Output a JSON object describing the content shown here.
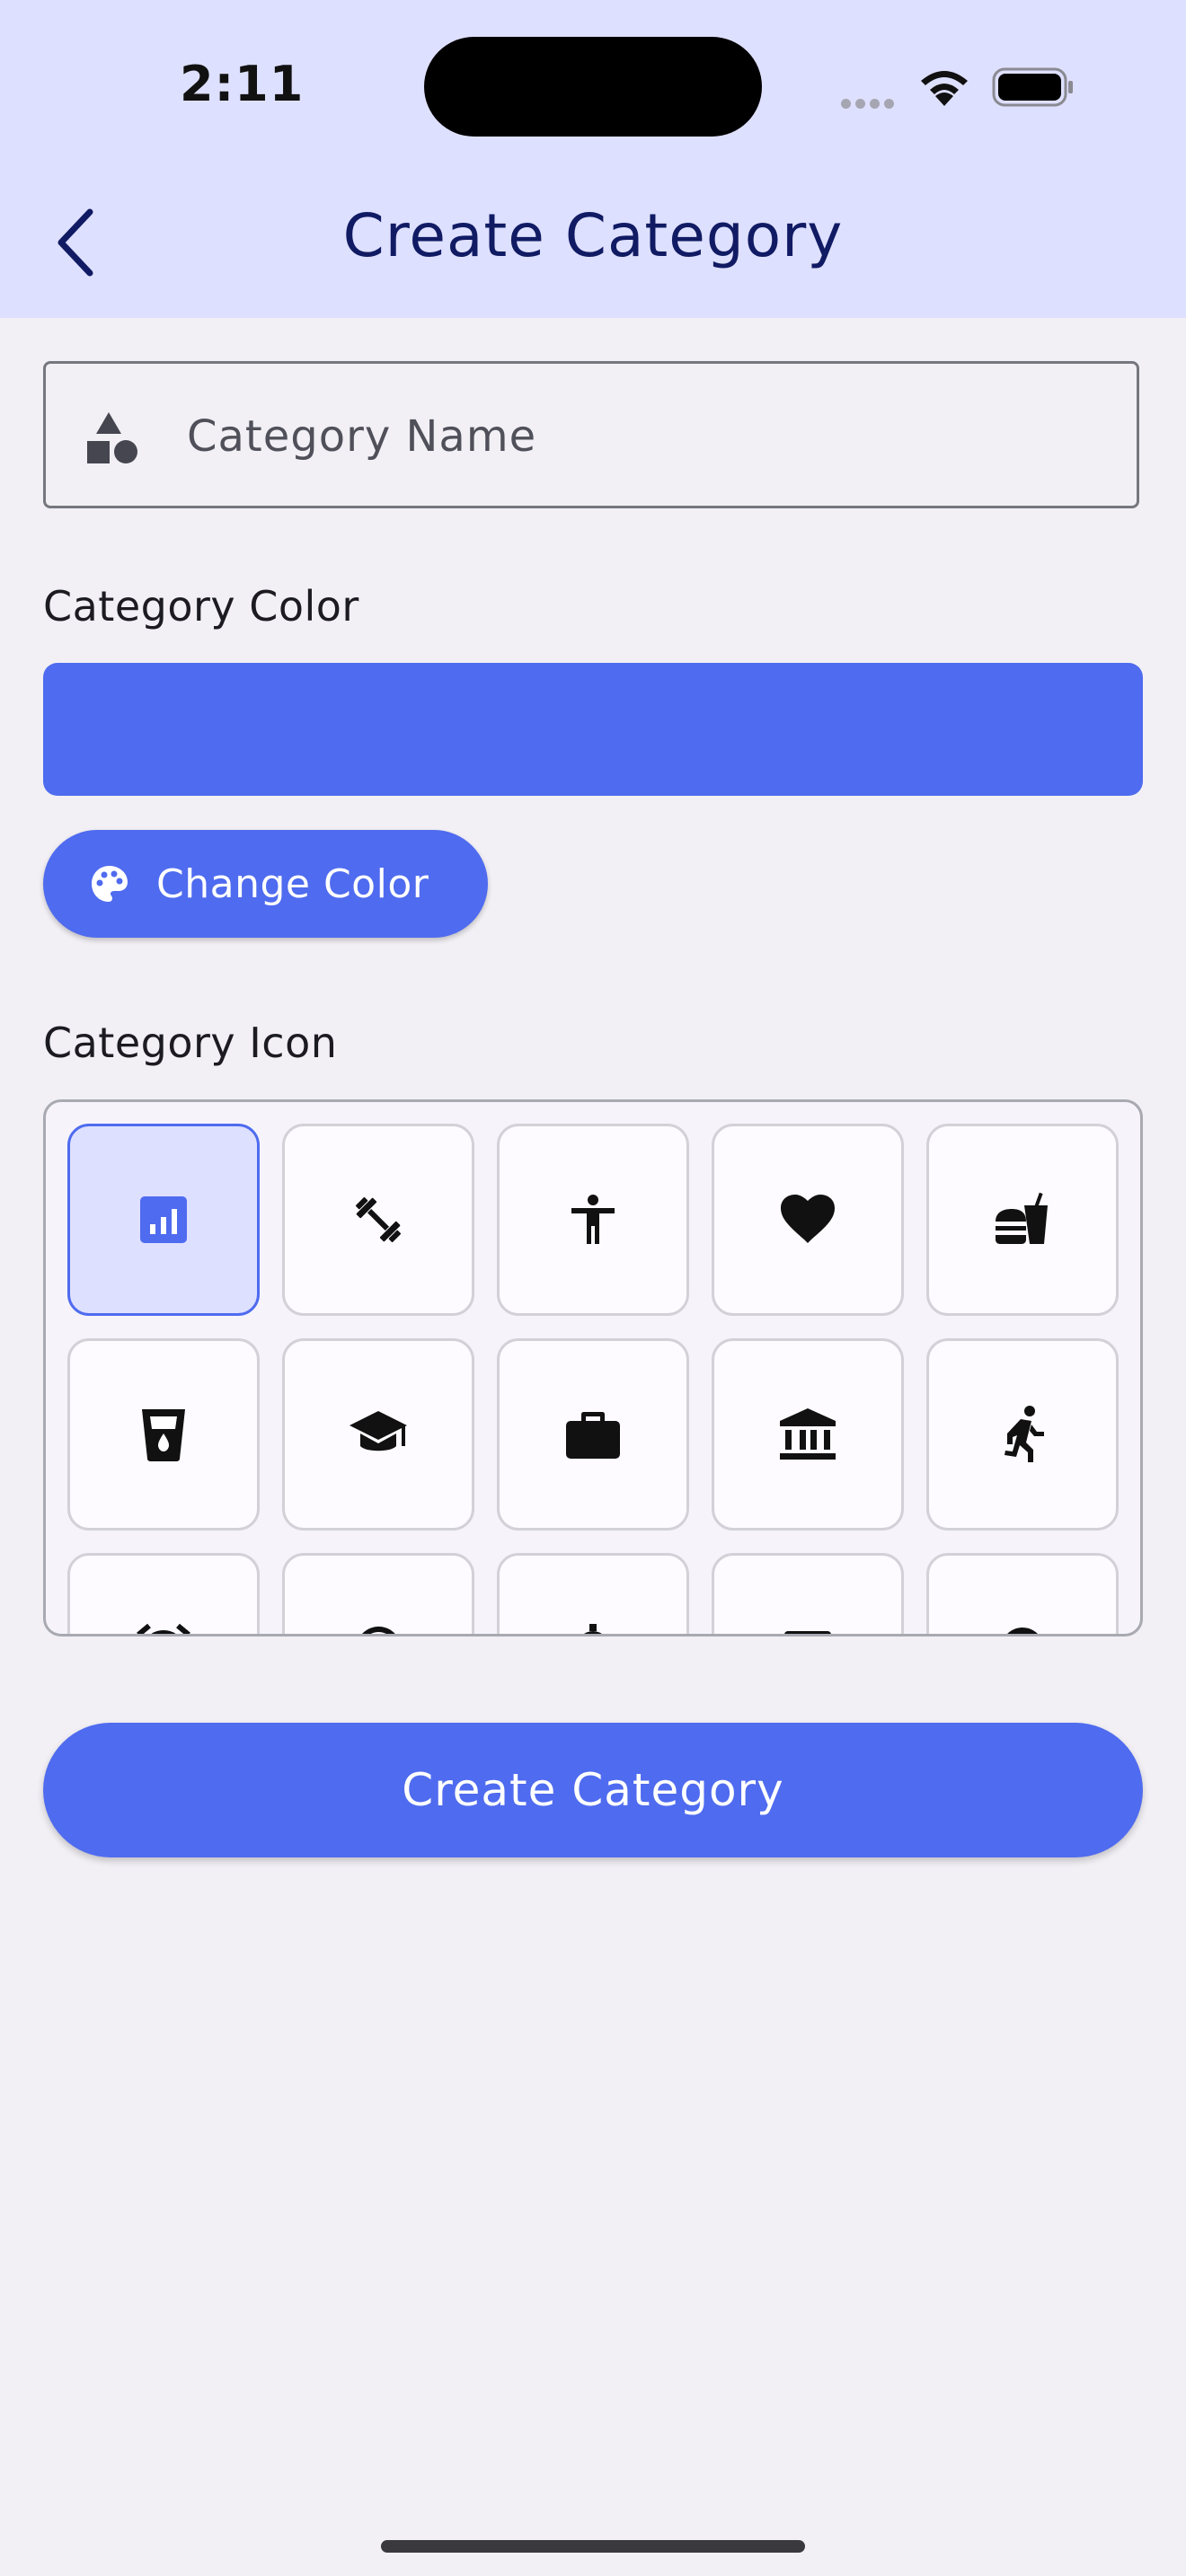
{
  "status_bar": {
    "time": "2:11"
  },
  "header": {
    "title": "Create Category"
  },
  "name_field": {
    "placeholder": "Category Name",
    "value": ""
  },
  "color_section": {
    "label": "Category Color",
    "selected_color": "#4f6bef",
    "change_button_label": "Change Color"
  },
  "icon_section": {
    "label": "Category Icon",
    "icons": [
      {
        "name": "bar-chart-icon",
        "selected": true
      },
      {
        "name": "dumbbell-icon",
        "selected": false
      },
      {
        "name": "accessibility-icon",
        "selected": false
      },
      {
        "name": "heart-icon",
        "selected": false
      },
      {
        "name": "fastfood-icon",
        "selected": false
      },
      {
        "name": "water-glass-icon",
        "selected": false
      },
      {
        "name": "graduation-cap-icon",
        "selected": false
      },
      {
        "name": "briefcase-icon",
        "selected": false
      },
      {
        "name": "bank-icon",
        "selected": false
      },
      {
        "name": "running-icon",
        "selected": false
      },
      {
        "name": "alarm-icon",
        "selected": false
      },
      {
        "name": "refresh-icon",
        "selected": false
      },
      {
        "name": "lightbulb-icon",
        "selected": false
      },
      {
        "name": "calendar-icon",
        "selected": false
      },
      {
        "name": "clock-icon",
        "selected": false
      }
    ]
  },
  "create_button": {
    "label": "Create Category"
  },
  "colors": {
    "accent": "#4f6bef",
    "header_bg": "#dee0ff",
    "title": "#101b63"
  }
}
